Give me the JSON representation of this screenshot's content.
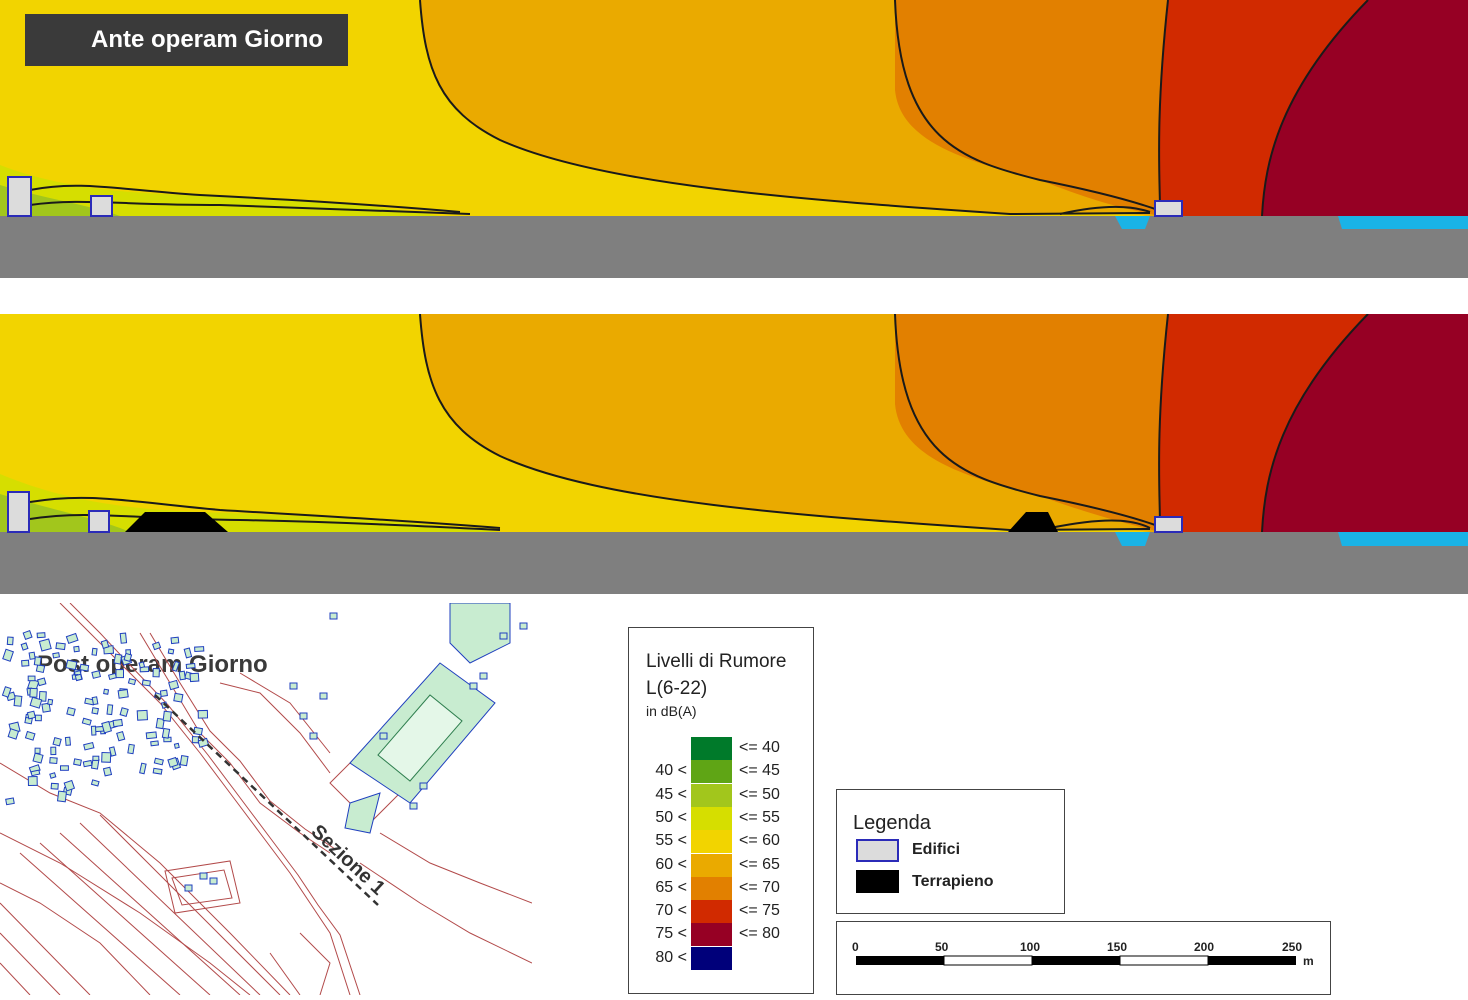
{
  "sections": {
    "ante": {
      "title": "Ante operam Giorno"
    },
    "post": {
      "title": "Post operam Giorno"
    }
  },
  "site_map": {
    "section_label": "Sezione 1"
  },
  "noise_legend": {
    "title_line1": "Livelli di Rumore",
    "title_line2": "L(6-22)",
    "unit": "in dB(A)",
    "classes": [
      {
        "lower": "",
        "upper": "<= 40",
        "color": "#007a2a"
      },
      {
        "lower": "40 <",
        "upper": "<= 45",
        "color": "#5fa515"
      },
      {
        "lower": "45 <",
        "upper": "<= 50",
        "color": "#a2c61c"
      },
      {
        "lower": "50 <",
        "upper": "<= 55",
        "color": "#d6de00"
      },
      {
        "lower": "55 <",
        "upper": "<= 60",
        "color": "#f2d400"
      },
      {
        "lower": "60 <",
        "upper": "<= 65",
        "color": "#eaaa00"
      },
      {
        "lower": "65 <",
        "upper": "<= 70",
        "color": "#e28000"
      },
      {
        "lower": "70 <",
        "upper": "<= 75",
        "color": "#d12a00"
      },
      {
        "lower": "75 <",
        "upper": "<= 80",
        "color": "#960024"
      },
      {
        "lower": "80 <",
        "upper": "",
        "color": "#00007a"
      }
    ]
  },
  "map_legend": {
    "title": "Legenda",
    "items": [
      {
        "label": "Edifici",
        "fill": "#dcdcdc",
        "stroke": "#2b2bb8"
      },
      {
        "label": "Terrapieno",
        "fill": "#000000",
        "stroke": "#000000"
      }
    ]
  },
  "scale_bar": {
    "labels": [
      "0",
      "50",
      "100",
      "150",
      "200",
      "250"
    ],
    "unit": "m"
  },
  "colors": {
    "ground": "#7f7f7f",
    "water": "#1ab3e6",
    "building_fill": "#dcdcdc",
    "building_stroke": "#2b2bb8",
    "contour": "#1a1a1a",
    "map_lines": "#b24a4a",
    "map_buildings": "#1f3fbf",
    "map_green": "#c8ecd0"
  }
}
